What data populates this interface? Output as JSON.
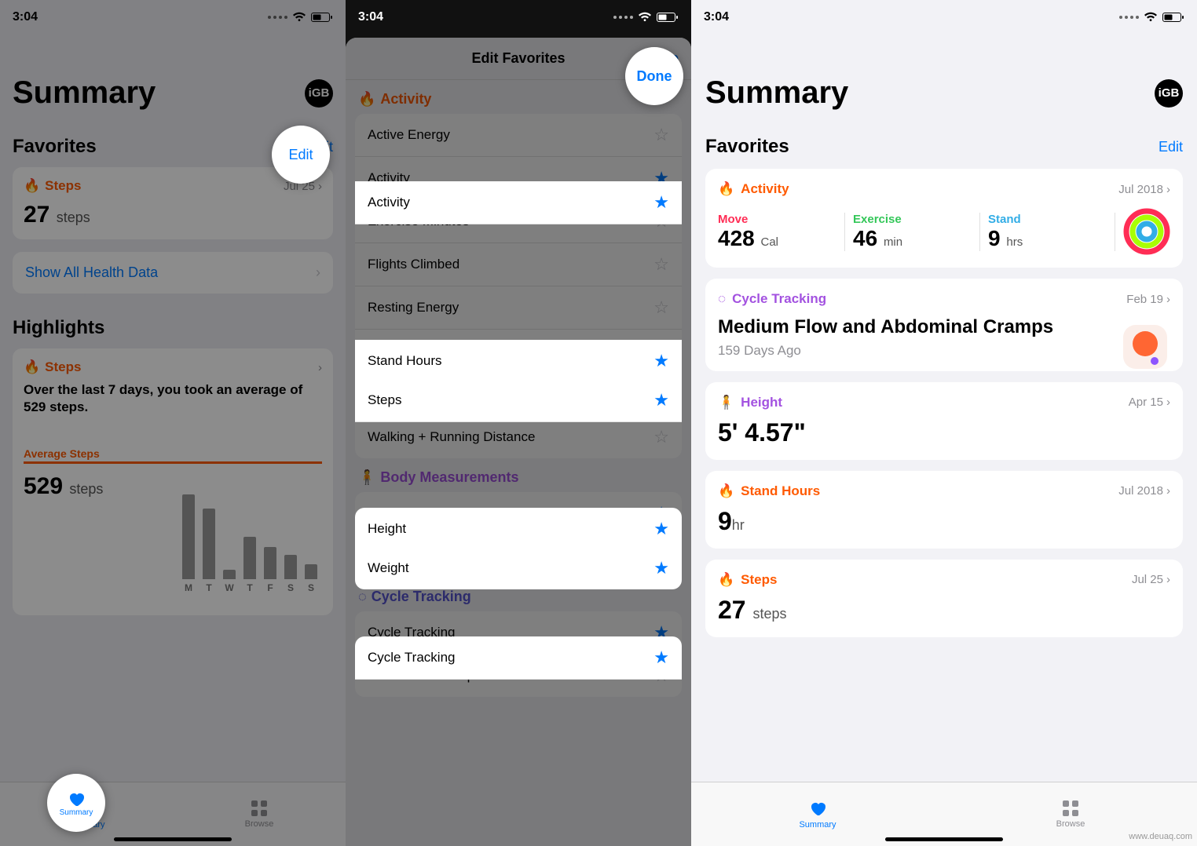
{
  "statusbar": {
    "time": "3:04"
  },
  "screen1": {
    "title": "Summary",
    "avatar": "iGB",
    "favorites_label": "Favorites",
    "edit": "Edit",
    "steps_card": {
      "title": "Steps",
      "date": "Jul 25",
      "value": "27",
      "unit": "steps"
    },
    "show_all": "Show All Health Data",
    "highlights_label": "Highlights",
    "hl_card": {
      "title": "Steps",
      "subtitle": "Over the last 7 days, you took an average of 529 steps.",
      "avg_label": "Average Steps",
      "avg_value": "529",
      "avg_unit": "steps"
    },
    "tabs": {
      "summary": "Summary",
      "browse": "Browse"
    }
  },
  "chart_data": {
    "type": "bar",
    "categories": [
      "M",
      "T",
      "W",
      "T",
      "F",
      "S",
      "S"
    ],
    "values": [
      900,
      750,
      100,
      450,
      340,
      260,
      160
    ],
    "title": "Average Steps",
    "average": 529,
    "ylim": [
      0,
      1000
    ]
  },
  "screen2": {
    "modal_title": "Edit Favorites",
    "done": "Done",
    "sections": [
      {
        "name": "Activity",
        "icon": "flame",
        "color": "#ff5a00",
        "items": [
          {
            "label": "Active Energy",
            "fav": false
          },
          {
            "label": "Activity",
            "fav": true
          },
          {
            "label": "Exercise Minutes",
            "fav": false
          },
          {
            "label": "Flights Climbed",
            "fav": false
          },
          {
            "label": "Resting Energy",
            "fav": false
          },
          {
            "label": "Stand Hours",
            "fav": true
          },
          {
            "label": "Steps",
            "fav": true
          },
          {
            "label": "Walking + Running Distance",
            "fav": false
          }
        ]
      },
      {
        "name": "Body Measurements",
        "icon": "person",
        "color": "#a352e0",
        "items": [
          {
            "label": "Height",
            "fav": true
          },
          {
            "label": "Weight",
            "fav": true
          }
        ]
      },
      {
        "name": "Cycle Tracking",
        "icon": "cycle",
        "color": "#5856d6",
        "items": [
          {
            "label": "Cycle Tracking",
            "fav": true
          },
          {
            "label": "Abdominal Cramps",
            "fav": false
          }
        ]
      }
    ]
  },
  "screen3": {
    "title": "Summary",
    "avatar": "iGB",
    "favorites_label": "Favorites",
    "edit": "Edit",
    "activity": {
      "title": "Activity",
      "date": "Jul 2018",
      "move": {
        "label": "Move",
        "value": "428",
        "unit": "Cal",
        "color": "#ff2d55"
      },
      "exercise": {
        "label": "Exercise",
        "value": "46",
        "unit": "min",
        "color": "#34c759"
      },
      "stand": {
        "label": "Stand",
        "value": "9",
        "unit": "hrs",
        "color": "#32ade6"
      }
    },
    "cycle": {
      "title": "Cycle Tracking",
      "date": "Feb 19",
      "headline": "Medium Flow and Abdominal Cramps",
      "ago": "159 Days Ago"
    },
    "height": {
      "title": "Height",
      "date": "Apr 15",
      "value": "5' 4.57\""
    },
    "stand": {
      "title": "Stand Hours",
      "date": "Jul 2018",
      "value": "9",
      "unit": "hr"
    },
    "steps": {
      "title": "Steps",
      "date": "Jul 25",
      "value": "27",
      "unit": "steps"
    },
    "tabs": {
      "summary": "Summary",
      "browse": "Browse"
    }
  },
  "watermark": "www.deuaq.com"
}
